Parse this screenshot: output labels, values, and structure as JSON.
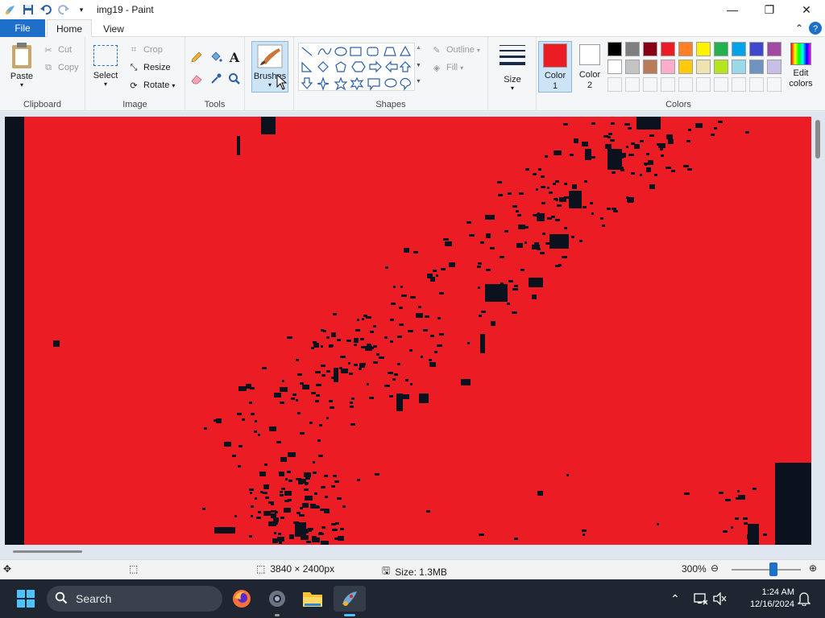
{
  "window": {
    "title": "img19 - Paint",
    "minimize_icon": "minimize-icon",
    "maximize_icon": "restore-icon",
    "close_icon": "close-icon"
  },
  "tabs": {
    "file": "File",
    "home": "Home",
    "view": "View"
  },
  "ribbon": {
    "clipboard": {
      "label": "Clipboard",
      "paste": "Paste",
      "cut": "Cut",
      "copy": "Copy"
    },
    "image": {
      "label": "Image",
      "select": "Select",
      "crop": "Crop",
      "resize": "Resize",
      "rotate": "Rotate"
    },
    "tools": {
      "label": "Tools"
    },
    "brushes": {
      "label": "Brushes"
    },
    "shapes": {
      "label": "Shapes",
      "outline": "Outline",
      "fill": "Fill"
    },
    "size": {
      "label": "Size"
    },
    "colors": {
      "label": "Colors",
      "color1_line1": "Color",
      "color1_line2": "1",
      "color2_line1": "Color",
      "color2_line2": "2",
      "edit_line1": "Edit",
      "edit_line2": "colors",
      "color1": "#ec1c24",
      "color2": "#ffffff",
      "palette_row1": [
        "#000000",
        "#7f7f7f",
        "#880015",
        "#ed1c24",
        "#ff7f27",
        "#fff200",
        "#22b14c",
        "#00a2e8",
        "#3f48cc",
        "#a349a4"
      ],
      "palette_row2": [
        "#ffffff",
        "#c3c3c3",
        "#b97a57",
        "#ffaec9",
        "#ffc90e",
        "#efe4b0",
        "#b5e61d",
        "#99d9ea",
        "#7092be",
        "#c8bfe7"
      ]
    }
  },
  "canvas": {
    "fill_color": "#ec1c24",
    "ink_color": "#0b111d"
  },
  "status": {
    "dimensions": "3840 × 2400px",
    "size": "Size: 1.3MB",
    "zoom": "300%"
  },
  "zoom_level": 0.5,
  "taskbar": {
    "search": "Search",
    "time": "1:24 AM",
    "date": "12/16/2024"
  }
}
